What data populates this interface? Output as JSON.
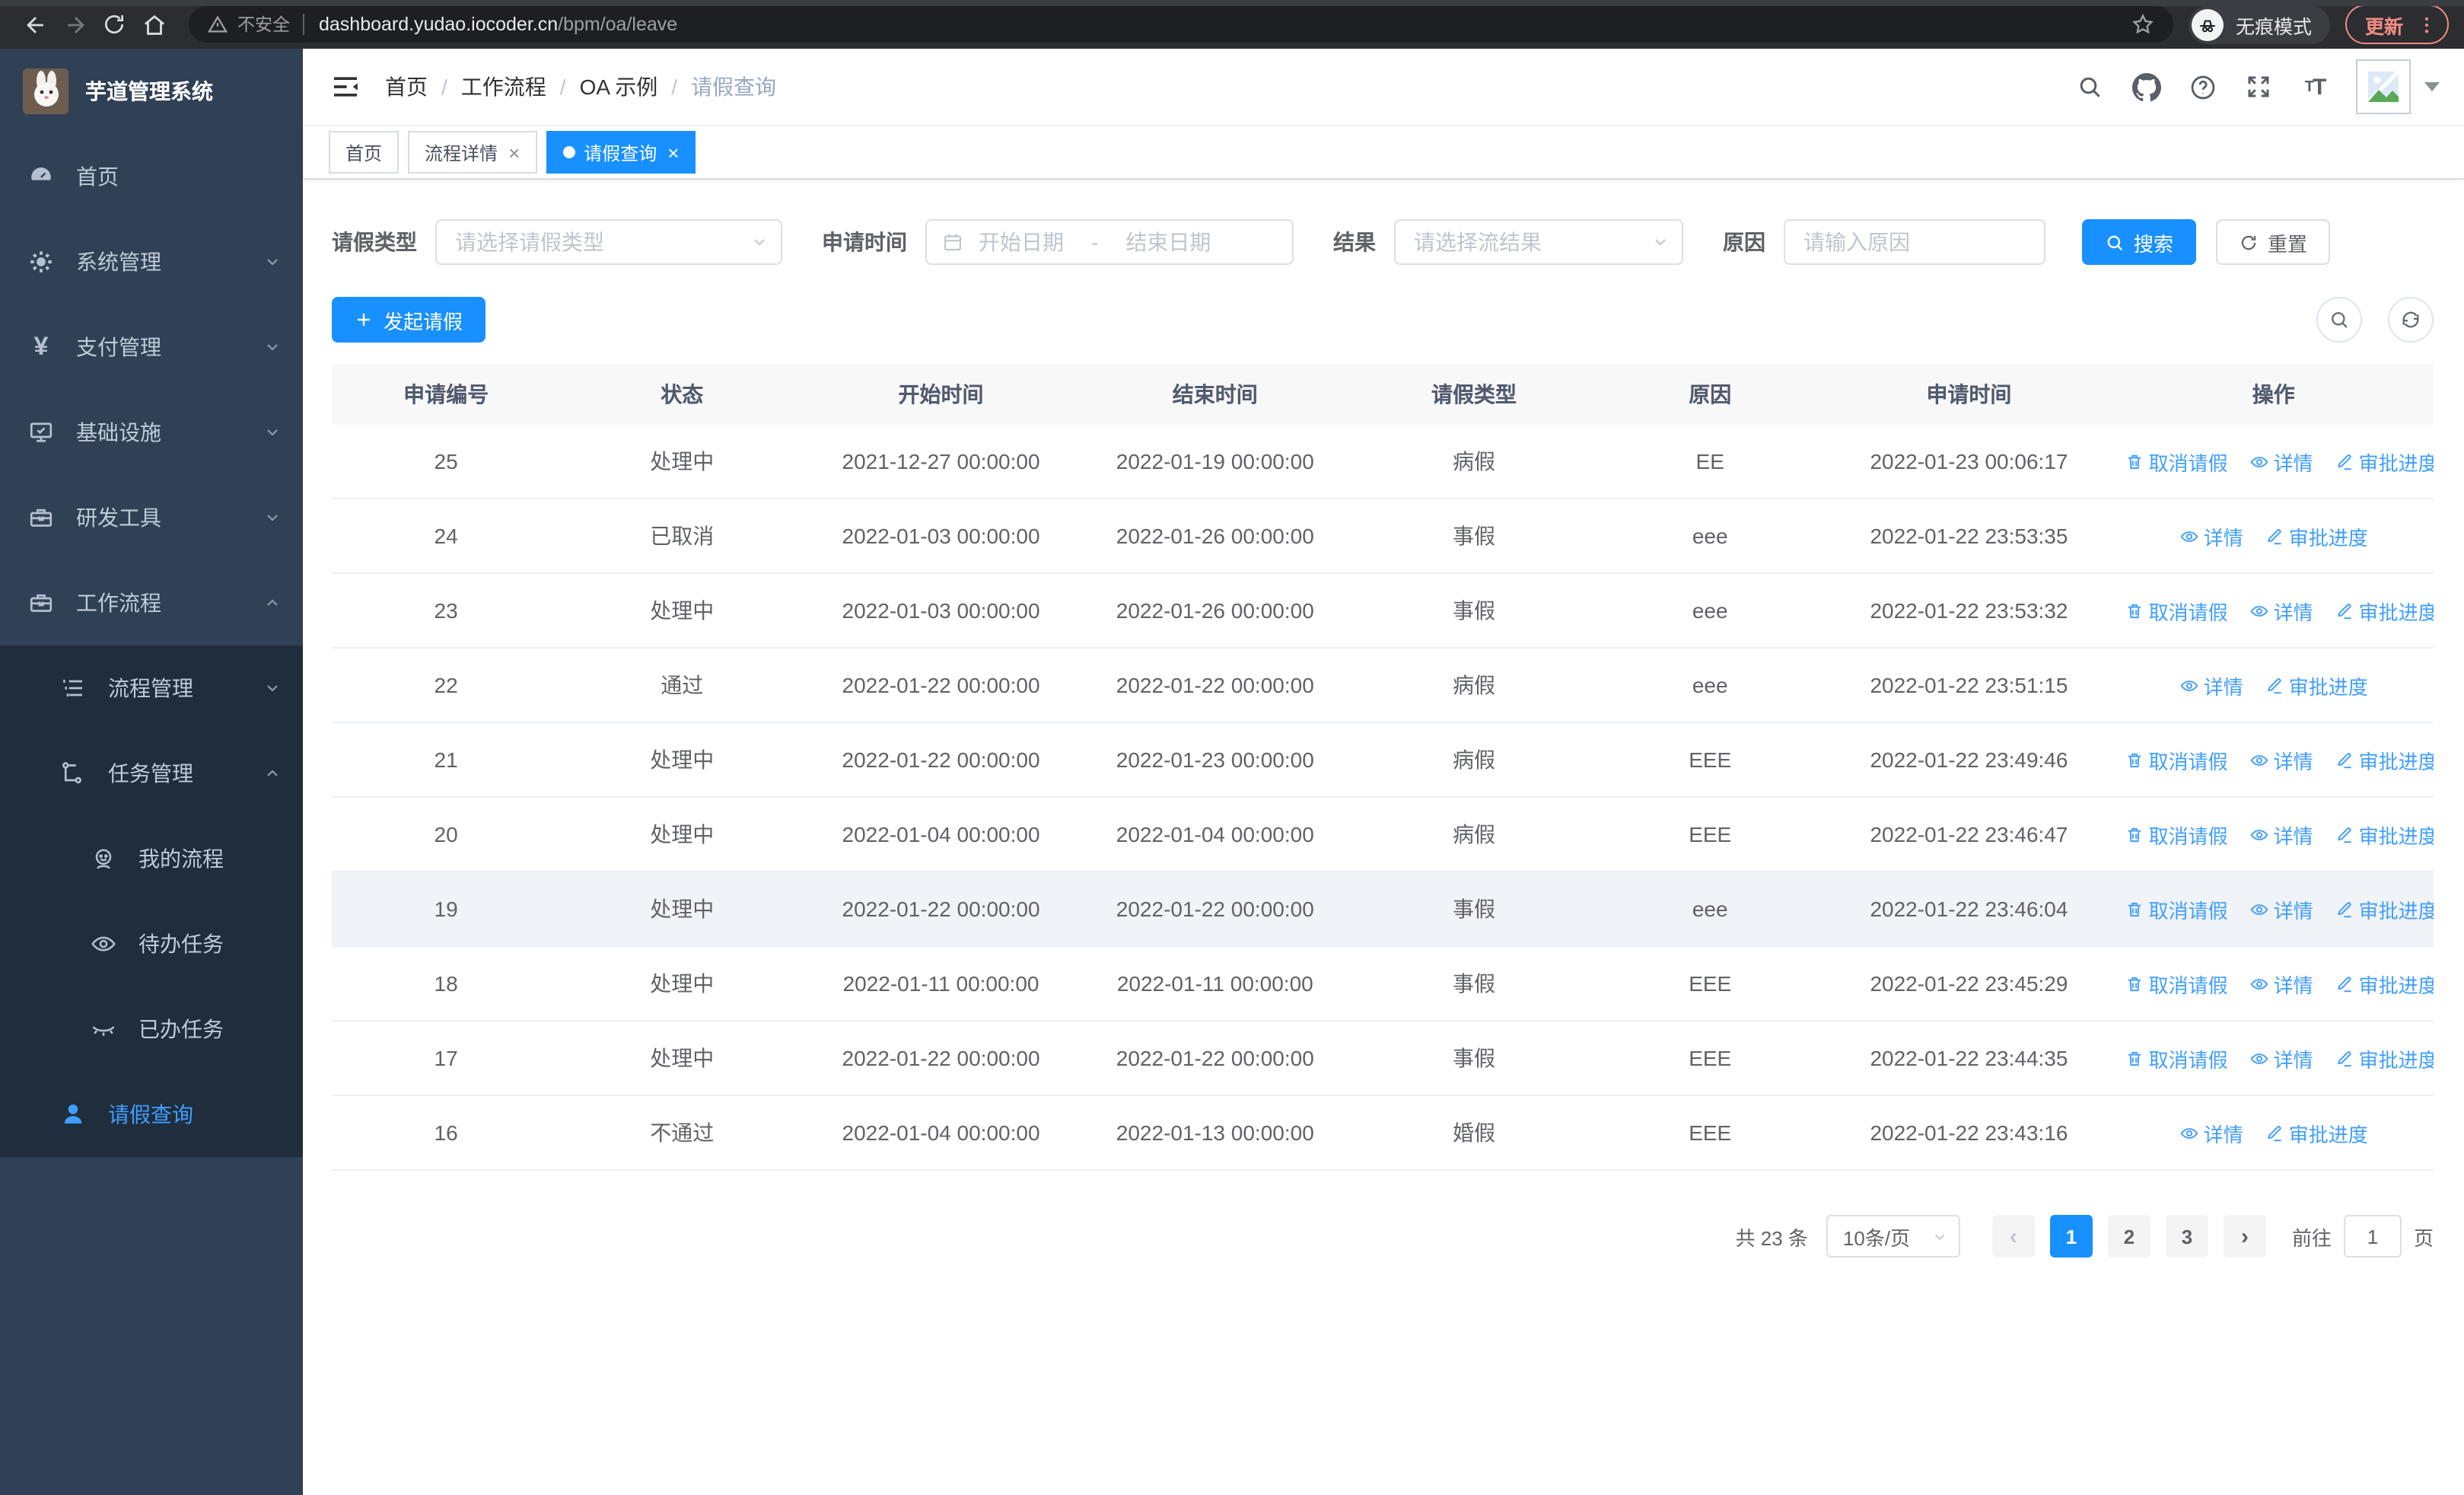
{
  "browser": {
    "security_label": "不安全",
    "url_host": "dashboard.yudao.iocoder.cn",
    "url_path": "/bpm/oa/leave",
    "incognito_label": "无痕模式",
    "update_label": "更新"
  },
  "sidebar": {
    "logo_title": "芋道管理系统",
    "home": "首页",
    "system": "系统管理",
    "pay": "支付管理",
    "infra": "基础设施",
    "dev_tools": "研发工具",
    "workflow": "工作流程",
    "process_mgmt": "流程管理",
    "task_mgmt": "任务管理",
    "my_process": "我的流程",
    "todo_tasks": "待办任务",
    "done_tasks": "已办任务",
    "leave_query": "请假查询"
  },
  "header": {
    "breadcrumb": [
      "首页",
      "工作流程",
      "OA 示例",
      "请假查询"
    ]
  },
  "tabs": [
    {
      "label": "首页",
      "closable": false,
      "active": false
    },
    {
      "label": "流程详情",
      "closable": true,
      "active": false
    },
    {
      "label": "请假查询",
      "closable": true,
      "active": true
    }
  ],
  "filters": {
    "leave_type_label": "请假类型",
    "leave_type_placeholder": "请选择请假类型",
    "apply_time_label": "申请时间",
    "start_date_placeholder": "开始日期",
    "range_separator": "-",
    "end_date_placeholder": "结束日期",
    "result_label": "结果",
    "result_placeholder": "请选择流结果",
    "reason_label": "原因",
    "reason_placeholder": "请输入原因",
    "search_button": "搜索",
    "reset_button": "重置"
  },
  "toolbar": {
    "create_button": "发起请假"
  },
  "table": {
    "columns": [
      "申请编号",
      "状态",
      "开始时间",
      "结束时间",
      "请假类型",
      "原因",
      "申请时间",
      "操作"
    ],
    "actions": {
      "cancel": "取消请假",
      "detail": "详情",
      "progress": "审批进度"
    },
    "rows": [
      {
        "id": "25",
        "status": "处理中",
        "start": "2021-12-27 00:00:00",
        "end": "2022-01-19 00:00:00",
        "type": "病假",
        "reason": "EE",
        "apply_time": "2022-01-23 00:06:17",
        "cancelable": true,
        "highlight": false
      },
      {
        "id": "24",
        "status": "已取消",
        "start": "2022-01-03 00:00:00",
        "end": "2022-01-26 00:00:00",
        "type": "事假",
        "reason": "eee",
        "apply_time": "2022-01-22 23:53:35",
        "cancelable": false,
        "highlight": false
      },
      {
        "id": "23",
        "status": "处理中",
        "start": "2022-01-03 00:00:00",
        "end": "2022-01-26 00:00:00",
        "type": "事假",
        "reason": "eee",
        "apply_time": "2022-01-22 23:53:32",
        "cancelable": true,
        "highlight": false
      },
      {
        "id": "22",
        "status": "通过",
        "start": "2022-01-22 00:00:00",
        "end": "2022-01-22 00:00:00",
        "type": "病假",
        "reason": "eee",
        "apply_time": "2022-01-22 23:51:15",
        "cancelable": false,
        "highlight": false
      },
      {
        "id": "21",
        "status": "处理中",
        "start": "2022-01-22 00:00:00",
        "end": "2022-01-23 00:00:00",
        "type": "病假",
        "reason": "EEE",
        "apply_time": "2022-01-22 23:49:46",
        "cancelable": true,
        "highlight": false
      },
      {
        "id": "20",
        "status": "处理中",
        "start": "2022-01-04 00:00:00",
        "end": "2022-01-04 00:00:00",
        "type": "病假",
        "reason": "EEE",
        "apply_time": "2022-01-22 23:46:47",
        "cancelable": true,
        "highlight": false
      },
      {
        "id": "19",
        "status": "处理中",
        "start": "2022-01-22 00:00:00",
        "end": "2022-01-22 00:00:00",
        "type": "事假",
        "reason": "eee",
        "apply_time": "2022-01-22 23:46:04",
        "cancelable": true,
        "highlight": true
      },
      {
        "id": "18",
        "status": "处理中",
        "start": "2022-01-11 00:00:00",
        "end": "2022-01-11 00:00:00",
        "type": "事假",
        "reason": "EEE",
        "apply_time": "2022-01-22 23:45:29",
        "cancelable": true,
        "highlight": false
      },
      {
        "id": "17",
        "status": "处理中",
        "start": "2022-01-22 00:00:00",
        "end": "2022-01-22 00:00:00",
        "type": "事假",
        "reason": "EEE",
        "apply_time": "2022-01-22 23:44:35",
        "cancelable": true,
        "highlight": false
      },
      {
        "id": "16",
        "status": "不通过",
        "start": "2022-01-04 00:00:00",
        "end": "2022-01-13 00:00:00",
        "type": "婚假",
        "reason": "EEE",
        "apply_time": "2022-01-22 23:43:16",
        "cancelable": false,
        "highlight": false
      }
    ]
  },
  "pagination": {
    "total_text": "共 23 条",
    "page_size_text": "10条/页",
    "pages": [
      "1",
      "2",
      "3"
    ],
    "active_page": "1",
    "prev_enabled": false,
    "next_enabled": true,
    "goto_label": "前往",
    "goto_value": "1",
    "goto_suffix": "页"
  },
  "colors": {
    "primary_fill": "#1890ff",
    "link_blue": "#409eff",
    "sidebar_bg": "#304156",
    "sidebar_submenu_bg": "#1f2d3d",
    "sidebar_text": "#bfcbd9",
    "update_salmon": "#f28b82",
    "breadcrumb_muted": "#97a8be",
    "table_header_bg": "#f8f8f9",
    "row_highlight": "#f0f3f7"
  },
  "icons": {
    "security": "warning-triangle",
    "bookmark": "star",
    "incognito": "hat-glasses",
    "search": "magnifier",
    "repo": "github",
    "help": "question-circle",
    "fullscreen": "expand-arrows",
    "font_size": "tT",
    "cancel": "trash",
    "detail": "eye",
    "progress": "pen"
  }
}
